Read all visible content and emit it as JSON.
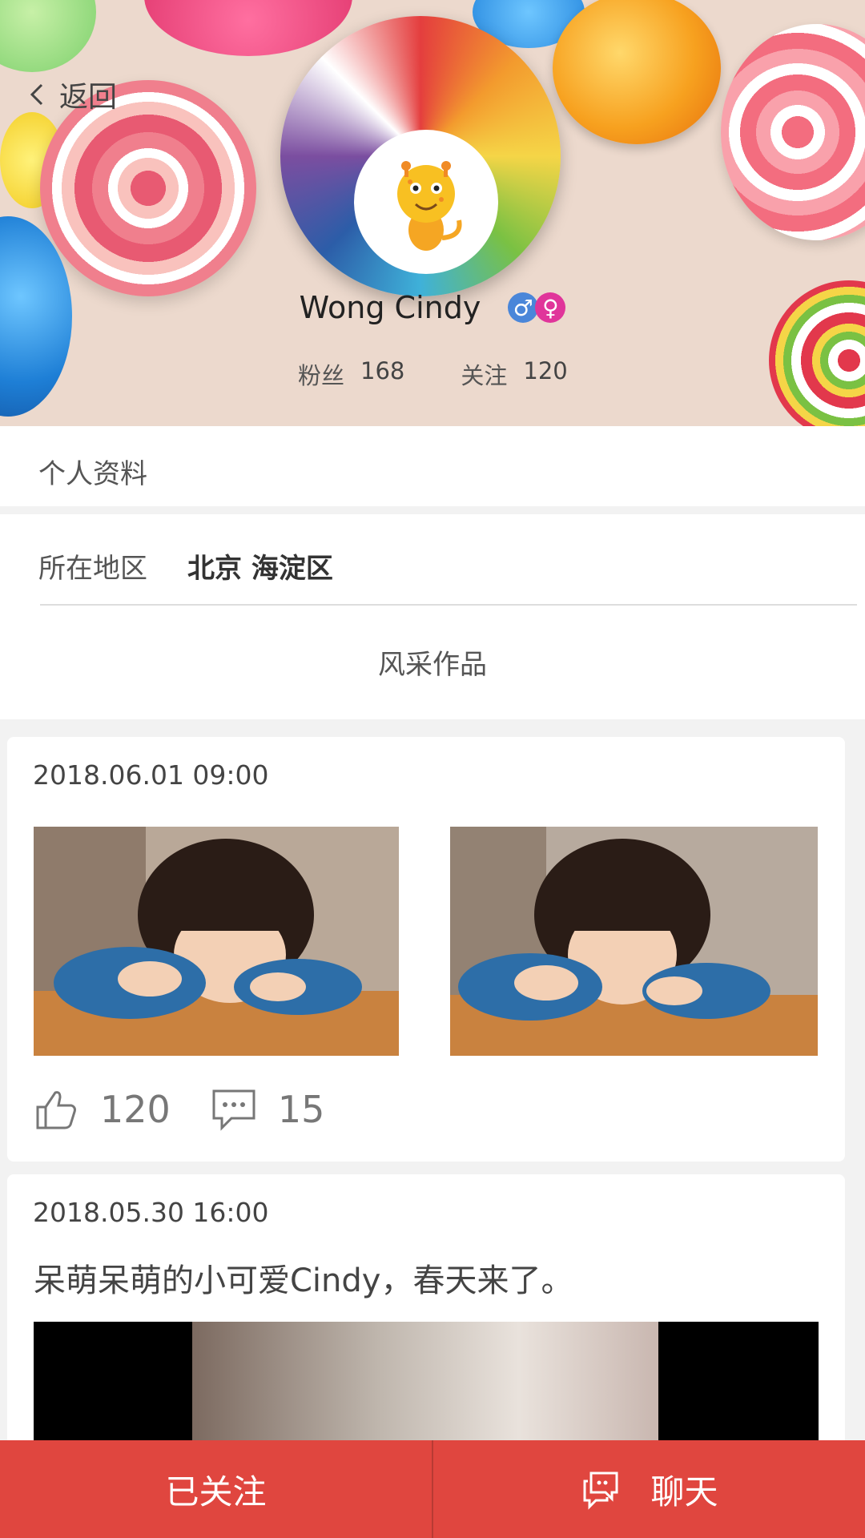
{
  "header": {
    "back_label": "返回",
    "user_name": "Wong Cindy",
    "gender_icons": [
      "male-symbol",
      "female-symbol"
    ],
    "fans_label": "粉丝",
    "fans_count": "168",
    "follow_label": "关注",
    "follow_count": "120"
  },
  "profile": {
    "section_title": "个人资料",
    "region_label": "所在地区",
    "region_value": "北京  海淀区",
    "works_title": "风采作品"
  },
  "posts": [
    {
      "time": "2018.06.01 09:00",
      "likes": "120",
      "comments": "15"
    },
    {
      "time": "2018.05.30 16:00",
      "text": "呆萌呆萌的小可爱Cindy，春天来了。"
    }
  ],
  "bottom_bar": {
    "followed_label": "已关注",
    "chat_label": "聊天"
  },
  "colors": {
    "accent": "#e0463f",
    "male": "#4a86d9",
    "female": "#e0359a"
  }
}
